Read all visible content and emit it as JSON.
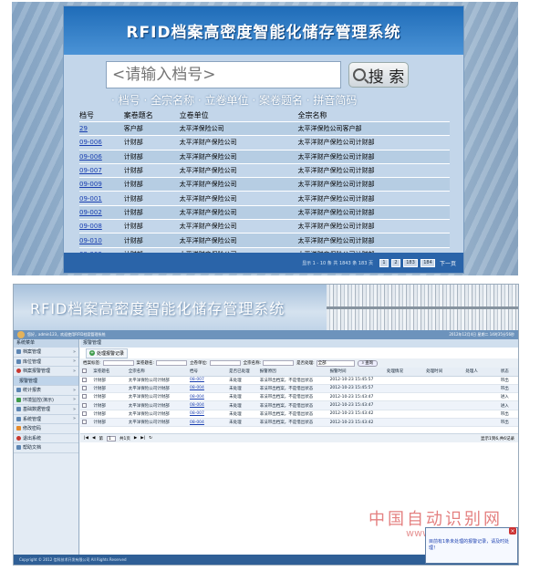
{
  "top": {
    "title": "RFID档案高密度智能化储存管理系统",
    "search": {
      "placeholder": "<请输入档号>",
      "button": "搜 索"
    },
    "hint": "· 档号 · 全宗名称 · 立卷单位 · 案卷题名 · 拼音简码",
    "table": {
      "headers": [
        "档号",
        "案卷题名",
        "立卷单位",
        "全宗名称"
      ],
      "rows": [
        [
          "29",
          "客户部",
          "太平洋保险公司",
          "太平洋保险公司客户部"
        ],
        [
          "09-006",
          "计财部",
          "太平洋财产保险公司",
          "太平洋财产保险公司计财部"
        ],
        [
          "09-006",
          "计财部",
          "太平洋财产保险公司",
          "太平洋财产保险公司计财部"
        ],
        [
          "09-007",
          "计财部",
          "太平洋财产保险公司",
          "太平洋财产保险公司计财部"
        ],
        [
          "09-009",
          "计财部",
          "太平洋财产保险公司",
          "太平洋财产保险公司计财部"
        ],
        [
          "09-001",
          "计财部",
          "太平洋财产保险公司",
          "太平洋财产保险公司计财部"
        ],
        [
          "09-002",
          "计财部",
          "太平洋财产保险公司",
          "太平洋财产保险公司计财部"
        ],
        [
          "09-008",
          "计财部",
          "太平洋财产保险公司",
          "太平洋财产保险公司计财部"
        ],
        [
          "09-010",
          "计财部",
          "太平洋财产保险公司",
          "太平洋财产保险公司计财部"
        ],
        [
          "09-003",
          "计财部",
          "太平洋财产保险公司",
          "太平洋财产保险公司计财部"
        ]
      ]
    },
    "pager": {
      "info": "显示 1 - 10 条 共 1843 条 183 页",
      "btn1": "1",
      "btn2": "2",
      "btn3": "183",
      "btn4": "184",
      "next": "下一页"
    }
  },
  "bottom": {
    "title": "RFID档案高密度智能化储存管理系统",
    "welcome": "您好，admin123，欢迎使用RFID档案管理系统",
    "date": "2012年12月4日 星期二 14时35分56秒",
    "sidebar": {
      "header": "系统菜单",
      "items": [
        {
          "label": "档案管理",
          "icon": "blue"
        },
        {
          "label": "库位管理",
          "icon": "blue"
        },
        {
          "label": "档案报警管理",
          "icon": "red"
        },
        {
          "label": "报警管理",
          "icon": "none",
          "sub": true
        },
        {
          "label": "统计报表",
          "icon": "blue"
        },
        {
          "label": "环境监控(演示)",
          "icon": "green"
        },
        {
          "label": "基础数据管理",
          "icon": "blue"
        },
        {
          "label": "系统管理",
          "icon": "blue"
        },
        {
          "label": "修改密码",
          "icon": "orange"
        },
        {
          "label": "退出系统",
          "icon": "red"
        },
        {
          "label": "帮助文档",
          "icon": "blue"
        }
      ]
    },
    "main": {
      "header": "报警管理",
      "add_button": "处理报警记录",
      "filters": {
        "f1": "档案标签:",
        "f2": "案卷题名:",
        "f3": "立卷单位:",
        "f4": "全宗名称:",
        "f5": "是否处理:",
        "select": "全部",
        "query": "查询"
      },
      "table": {
        "headers": [
          "案卷题名",
          "全宗名称",
          "档号",
          "是否已处理",
          "报警原因",
          "报警时间",
          "处理情况",
          "处理时间",
          "处理人",
          "状态"
        ],
        "rows": [
          [
            "计财部",
            "太平洋保险公司计财部",
            "08-007",
            "未处理",
            "非法带出档案，不是借出状态",
            "2012-10-23 15:45:57",
            "",
            "",
            "",
            "带出"
          ],
          [
            "计财部",
            "太平洋保险公司计财部",
            "08-004",
            "未处理",
            "非法带出档案，不是借出状态",
            "2012-10-23 15:45:57",
            "",
            "",
            "",
            "带出"
          ],
          [
            "计财部",
            "太平洋保险公司计财部",
            "08-004",
            "未处理",
            "非法带出档案，不是借出状态",
            "2012-10-23 15:43:47",
            "",
            "",
            "",
            "进入"
          ],
          [
            "计财部",
            "太平洋保险公司计财部",
            "08-004",
            "未处理",
            "非法带出档案，不是借出状态",
            "2012-10-23 15:43:47",
            "",
            "",
            "",
            "进入"
          ],
          [
            "计财部",
            "太平洋保险公司计财部",
            "08-007",
            "未处理",
            "非法带出档案，不是借出状态",
            "2012-10-23 15:43:42",
            "",
            "",
            "",
            "带出"
          ],
          [
            "计财部",
            "太平洋保险公司计财部",
            "08-004",
            "未处理",
            "非法带出档案，不是借出状态",
            "2012-10-23 15:43:42",
            "",
            "",
            "",
            "带出"
          ]
        ]
      },
      "pager": {
        "page_label": "第",
        "page_value": "1",
        "total": "共1页",
        "right": "显示1到6,共6记录"
      }
    },
    "footer": {
      "left": "Copyright © 2012 信科技术开发有限公司 All Rights Reserved",
      "right": "系统版本：V1.0"
    }
  },
  "watermark": {
    "text": "中国自动识别网",
    "url": "www.CNAIDC.COM"
  },
  "popup": {
    "text": "目前有1条未处理的报警记录，请及时处理！"
  }
}
